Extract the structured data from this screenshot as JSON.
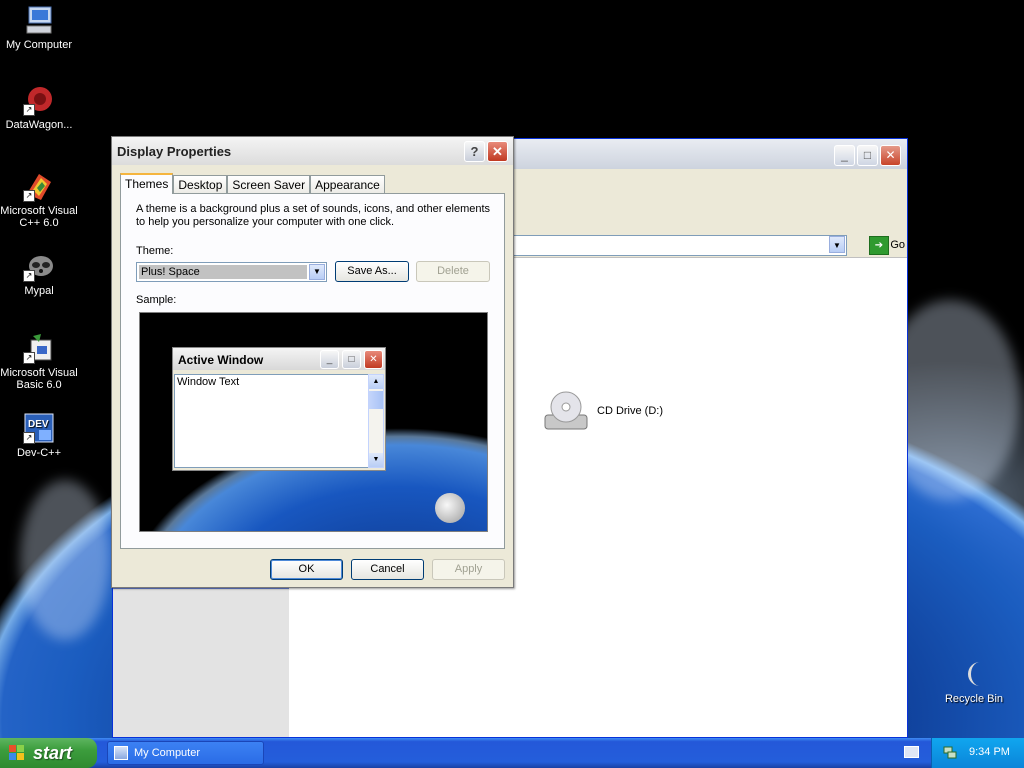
{
  "desktop": {
    "icons": [
      {
        "label": "My Computer",
        "icon": "my-computer-icon"
      },
      {
        "label": "DataWagon...",
        "icon": "datawagon-icon"
      },
      {
        "label": "Microsoft Visual C++ 6.0",
        "icon": "visual-cpp-icon"
      },
      {
        "label": "Mypal",
        "icon": "mypal-icon"
      },
      {
        "label": "Microsoft Visual Basic 6.0",
        "icon": "visual-basic-icon"
      },
      {
        "label": "Dev-C++",
        "icon": "dev-cpp-icon"
      },
      {
        "label": "Recycle Bin",
        "icon": "recycle-bin-icon"
      }
    ]
  },
  "my_computer_window": {
    "address": {
      "go_label": "Go"
    },
    "items": [
      {
        "label": "CD Drive (D:)",
        "icon": "cd-drive-icon"
      }
    ]
  },
  "dialog": {
    "title": "Display Properties",
    "help_label": "?",
    "tabs": [
      {
        "label": "Themes",
        "active": true
      },
      {
        "label": "Desktop",
        "active": false
      },
      {
        "label": "Screen Saver",
        "active": false
      },
      {
        "label": "Appearance",
        "active": false
      }
    ],
    "description": "A theme is a background plus a set of sounds, icons, and other elements to help you personalize your computer with one click.",
    "theme_label": "Theme:",
    "theme_value": "Plus! Space",
    "save_as_label": "Save As...",
    "delete_label": "Delete",
    "sample_label": "Sample:",
    "sample_window": {
      "title": "Active Window",
      "text": "Window Text"
    },
    "ok_label": "OK",
    "cancel_label": "Cancel",
    "apply_label": "Apply"
  },
  "taskbar": {
    "start_label": "start",
    "task_item": "My Computer",
    "clock": "9:34 PM"
  },
  "colors": {
    "taskbar_blue": "#245edb",
    "start_green": "#3c9d3d",
    "close_red": "#c13a22",
    "dialog_face": "#ece9d8"
  }
}
